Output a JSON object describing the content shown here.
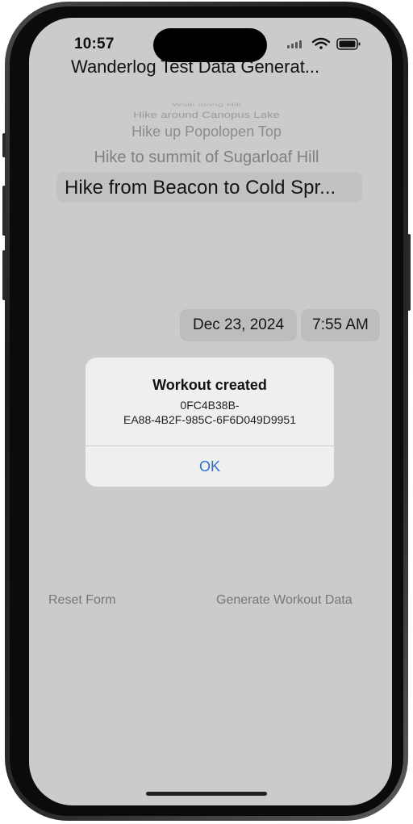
{
  "status_bar": {
    "time": "10:57",
    "icons": [
      "cellular-icon",
      "wifi-icon",
      "battery-icon"
    ]
  },
  "nav": {
    "title": "Wanderlog Test Data Generat..."
  },
  "hike_picker": {
    "items": [
      "Walk along Hill",
      "Hike around Canopus Lake",
      "Hike up Popolopen Top",
      "Hike to summit of Sugarloaf Hill"
    ],
    "selected": "Hike from Beacon to Cold Spr..."
  },
  "date_time": {
    "date": "Dec 23, 2024",
    "time": "7:55 AM"
  },
  "alert": {
    "title": "Workout created",
    "message": "0FC4B38B-\nEA88-4B2F-985C-6F6D049D9951",
    "ok_label": "OK",
    "ok_color": "#2f6fd0"
  },
  "actions": {
    "reset_label": "Reset Form",
    "generate_label": "Generate Workout Data"
  },
  "colors": {
    "screen_background": "#cbcbcb",
    "alert_background": "#efefef"
  }
}
